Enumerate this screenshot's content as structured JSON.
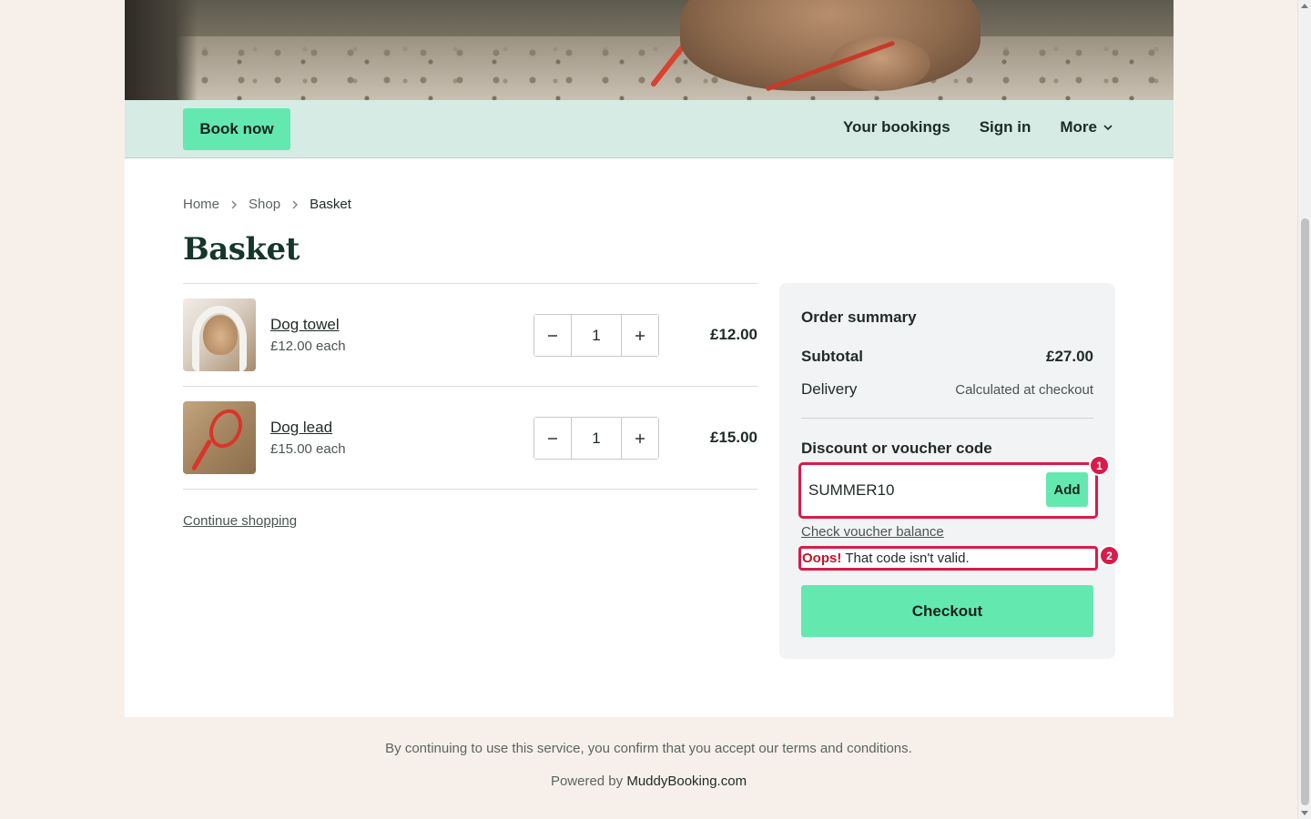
{
  "nav": {
    "book_now": "Book now",
    "your_bookings": "Your bookings",
    "sign_in": "Sign in",
    "more": "More"
  },
  "breadcrumb": [
    "Home",
    "Shop",
    "Basket"
  ],
  "page_title": "Basket",
  "items": [
    {
      "name": "Dog towel",
      "each": "£12.00 each",
      "quantity": "1",
      "total": "£12.00",
      "image_icon": "dog-towel-photo"
    },
    {
      "name": "Dog lead",
      "each": "£15.00 each",
      "quantity": "1",
      "total": "£15.00",
      "image_icon": "dog-lead-photo"
    }
  ],
  "continue_shopping": "Continue shopping",
  "summary": {
    "title": "Order summary",
    "subtotal_label": "Subtotal",
    "subtotal_value": "£27.00",
    "delivery_label": "Delivery",
    "delivery_value": "Calculated at checkout",
    "discount_label": "Discount or voucher code",
    "voucher_value": "SUMMER10",
    "add_label": "Add",
    "check_balance": "Check voucher balance",
    "error_strong": "Oops!",
    "error_text": "That code isn't valid.",
    "checkout_label": "Checkout",
    "badge_1": "1",
    "badge_2": "2"
  },
  "footer": {
    "terms": "By continuing to use this service, you confirm that you accept our terms and conditions.",
    "powered_prefix": "Powered by",
    "powered_brand": "MuddyBooking.com"
  },
  "colors": {
    "accent": "#63e8b0",
    "nav_bg": "#d5ebe3",
    "error": "#d81b4a",
    "page_bg": "#f7f0ea"
  }
}
